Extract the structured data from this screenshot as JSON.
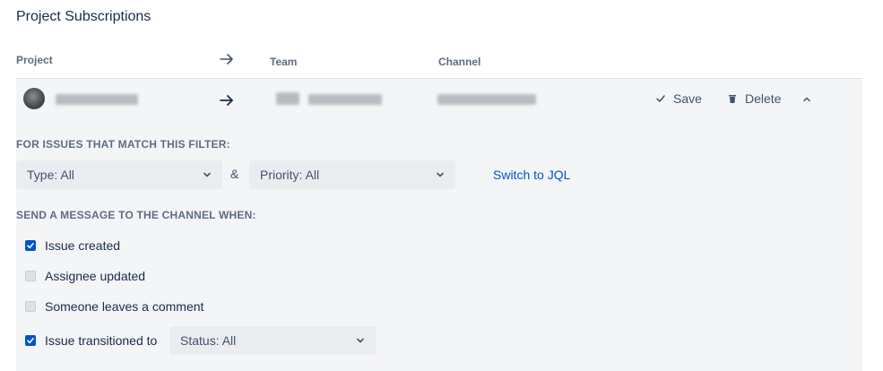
{
  "title": "Project Subscriptions",
  "headers": {
    "project": "Project",
    "team": "Team",
    "channel": "Channel"
  },
  "actions": {
    "save": "Save",
    "delete": "Delete"
  },
  "filter": {
    "label": "FOR ISSUES THAT MATCH THIS FILTER:",
    "type_value": "Type: All",
    "ampersand": "&",
    "priority_value": "Priority: All",
    "switch_link": "Switch to JQL"
  },
  "events": {
    "label": "SEND A MESSAGE TO THE CHANNEL WHEN:",
    "items": [
      {
        "label": "Issue created",
        "checked": true
      },
      {
        "label": "Assignee updated",
        "checked": false
      },
      {
        "label": "Someone leaves a comment",
        "checked": false
      },
      {
        "label": "Issue transitioned to",
        "checked": true
      }
    ],
    "status_value": "Status: All"
  },
  "colors": {
    "accent": "#0052cc",
    "panel": "#f4f5f7",
    "link": "#0052cc"
  }
}
